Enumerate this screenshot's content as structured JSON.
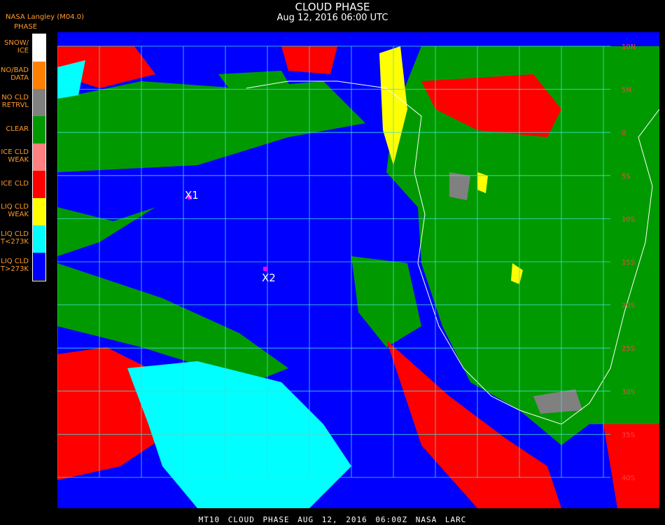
{
  "header": {
    "title": "CLOUD PHASE",
    "date": "Aug 12, 2016 06:00 UTC",
    "source": "NASA Langley (M04.0)"
  },
  "legend": {
    "title": "PHASE",
    "items": [
      {
        "label": "SNOW/\nICE",
        "color": "#ffffff"
      },
      {
        "label": "NO/BAD\nDATA",
        "color": "#ff8000"
      },
      {
        "label": "NO CLD\nRETRVL",
        "color": "#808080"
      },
      {
        "label": "CLEAR",
        "color": "#009a00"
      },
      {
        "label": "ICE CLD\nWEAK",
        "color": "#ff8080"
      },
      {
        "label": "ICE CLD",
        "color": "#ff0000"
      },
      {
        "label": "LIQ CLD\nWEAK",
        "color": "#ffff00"
      },
      {
        "label": "LIQ CLD\nT<273K",
        "color": "#00ffff"
      },
      {
        "label": "LIQ CLD\nT>273K",
        "color": "#0000ff"
      }
    ]
  },
  "map": {
    "markers": [
      {
        "label": "X1",
        "color": "#ff00ff"
      },
      {
        "label": "X2",
        "color": "#ff00ff"
      }
    ],
    "lat_labels": [
      "10N",
      "5N",
      "0",
      "5S",
      "10S",
      "15S",
      "20S",
      "25S",
      "30S",
      "35S",
      "40S"
    ],
    "grid_color": "#40e0d0"
  },
  "footer": {
    "text": "MT10  CLOUD PHASE   AUG 12, 2016 06:00Z   NASA LARC"
  }
}
